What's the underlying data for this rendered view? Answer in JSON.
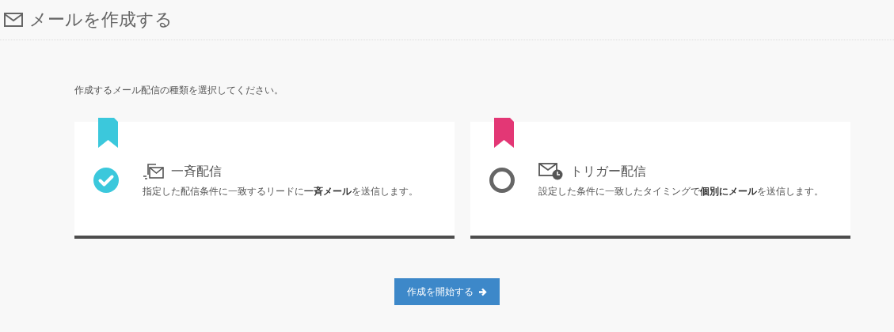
{
  "page_title": "メールを作成する",
  "instruction": "作成するメール配信の種類を選択してください。",
  "options": [
    {
      "kind": "bulk",
      "title": "一斉配信",
      "description": "指定した配信条件に一致するリードに**一斉メール**を送信します。",
      "selected": true,
      "color": "#3bc8dc"
    },
    {
      "kind": "trigger",
      "title": "トリガー配信",
      "description": "設定した条件に一致したタイミングで**個別にメール**を送信します。",
      "selected": false,
      "color": "#e33775"
    }
  ],
  "start_button": "作成を開始する"
}
